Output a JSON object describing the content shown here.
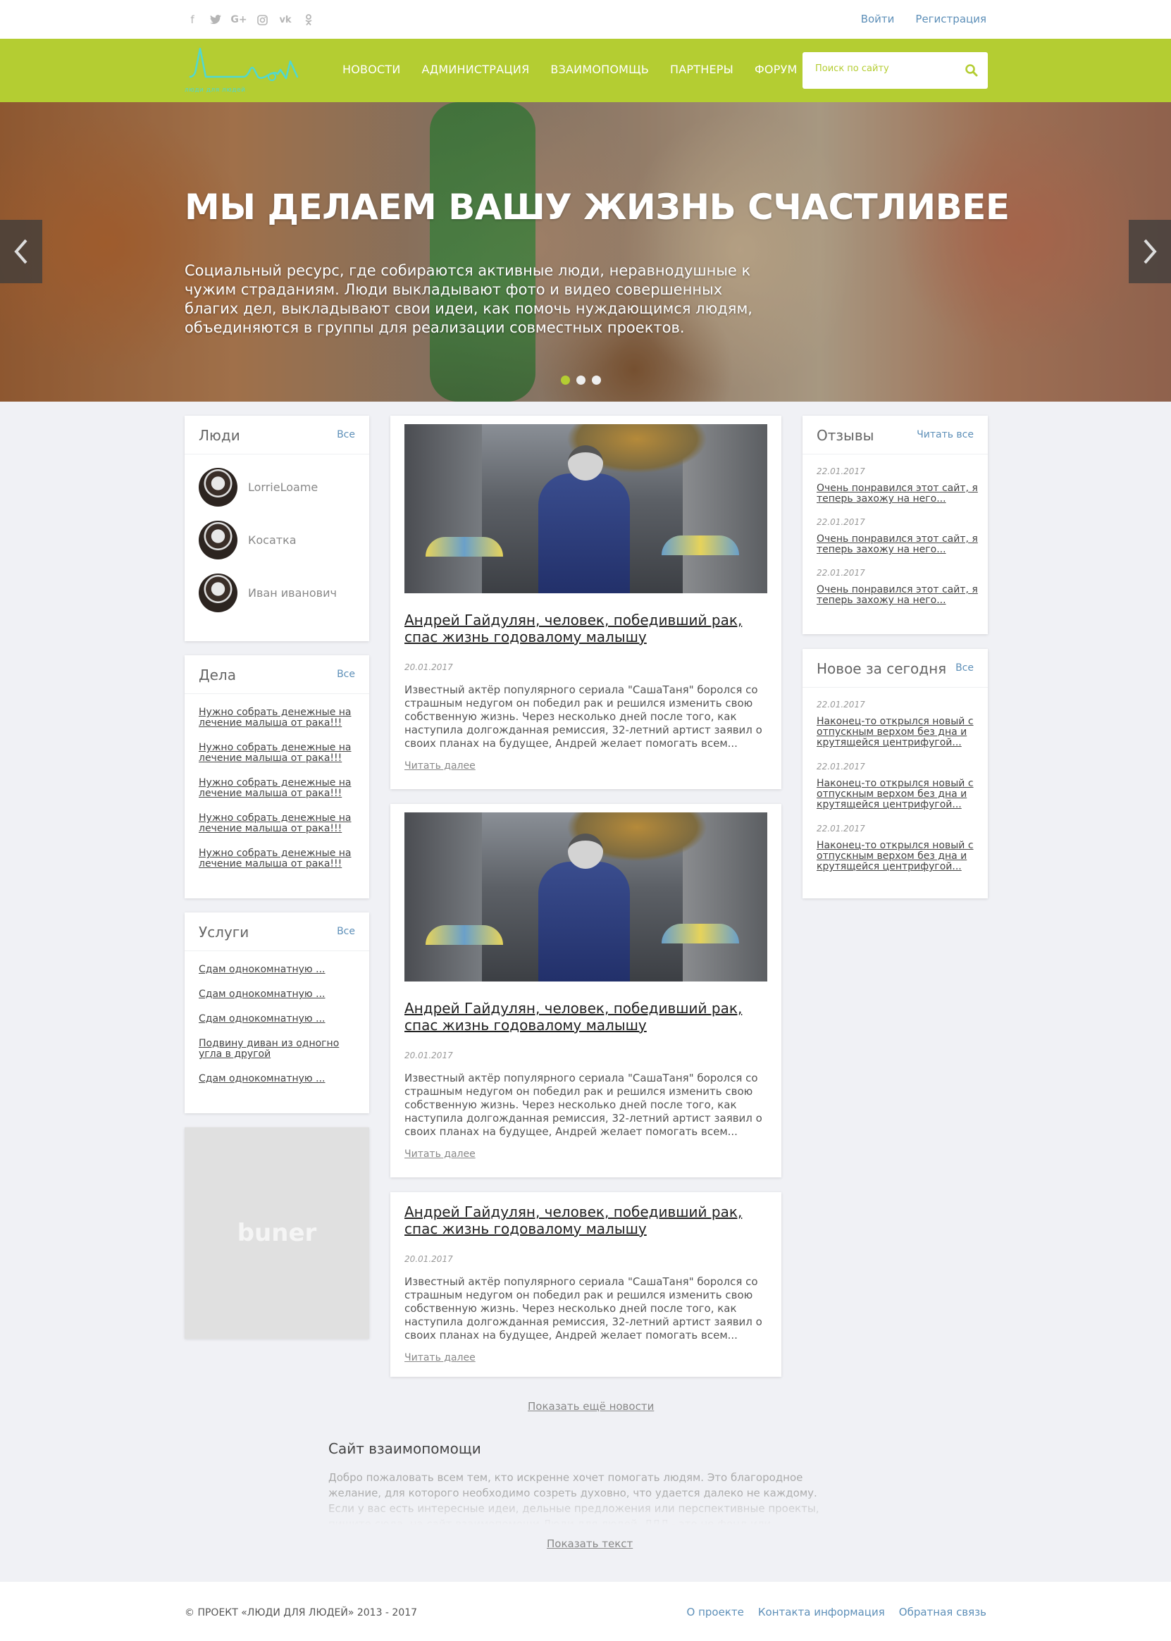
{
  "topbar": {
    "socials": [
      {
        "name": "facebook-icon",
        "glyph": "f"
      },
      {
        "name": "twitter-icon",
        "glyph": "🐦"
      },
      {
        "name": "google-plus-icon",
        "glyph": "G+"
      },
      {
        "name": "instagram-icon",
        "glyph": "◎"
      },
      {
        "name": "vk-icon",
        "glyph": "vk"
      },
      {
        "name": "odnoklassniki-icon",
        "glyph": "ok"
      }
    ],
    "login": "Войти",
    "register": "Регистрация"
  },
  "nav": {
    "logo_text": "люди для людей",
    "items": [
      "НОВОСТИ",
      "АДМИНИСТРАЦИЯ",
      "ВЗАИМОПОМЩЬ",
      "ПАРТНЕРЫ",
      "ФОРУМ"
    ],
    "search_placeholder": "Поиск по сайту",
    "accent": "#b4cd32"
  },
  "hero": {
    "title": "МЫ ДЕЛАЕМ ВАШУ ЖИЗНЬ СЧАСТЛИВЕЕ",
    "text": "Социальный ресурс, где собираются активные люди, неравнодушные к чужим страданиям. Люди выкладывают фото и видео совершенных благих дел, выкладывают свои идеи, как помочь нуждающимся людям, объединяются в группы для реализации совместных проектов.",
    "slides": 3,
    "active_slide": 1
  },
  "people": {
    "title": "Люди",
    "all": "Все",
    "items": [
      "LorrieLoame",
      "Косатка",
      "Иван иванович"
    ]
  },
  "deeds": {
    "title": "Дела",
    "all": "Все",
    "items": [
      "Нужно собрать денежные на лечение малыша от рака!!!",
      "Нужно собрать денежные на лечение малыша от рака!!!",
      "Нужно собрать денежные на лечение малыша от рака!!!",
      "Нужно собрать денежные на лечение малыша от рака!!!",
      "Нужно собрать денежные на лечение малыша от рака!!!"
    ]
  },
  "services": {
    "title": "Услуги",
    "all": "Все",
    "items": [
      "Сдам однокомнатную ...",
      "Сдам однокомнатную ...",
      "Сдам однокомнатную ...",
      "Подвину диван из одногно угла в другой",
      "Сдам однокомнатную ..."
    ]
  },
  "banner": {
    "text": "buner"
  },
  "news": [
    {
      "title": "Андрей Гайдулян, человек, победивший рак, спас жизнь годовалому малышу",
      "date": "20.01.2017",
      "text": "Известный актёр популярного сериала \"СашаТаня\" боролся со страшным недугом он победил рак и решился изменить свою собственную жизнь. Через несколько дней после того, как наступила долгожданная ремиссия, 32-летний артист заявил о своих планах на будущее, Андрей желает помогать всем...",
      "more": "Читать далее"
    },
    {
      "title": "Андрей Гайдулян, человек, победивший рак, спас жизнь годовалому малышу",
      "date": "20.01.2017",
      "text": "Известный актёр популярного сериала \"СашаТаня\" боролся со страшным недугом он победил рак и решился изменить свою собственную жизнь. Через несколько дней после того, как наступила долгожданная ремиссия, 32-летний артист заявил о своих планах на будущее, Андрей желает помогать всем...",
      "more": "Читать далее"
    },
    {
      "title": "Андрей Гайдулян, человек, победивший рак, спас жизнь годовалому малышу",
      "date": "20.01.2017",
      "text": "Известный актёр популярного сериала \"СашаТаня\" боролся со страшным недугом он победил рак и решился изменить свою собственную жизнь. Через несколько дней после того, как наступила долгожданная ремиссия, 32-летний артист заявил о своих планах на будущее, Андрей желает помогать всем...",
      "more": "Читать далее"
    }
  ],
  "more_news": "Показать ещё новости",
  "reviews": {
    "title": "Отзывы",
    "all": "Читать все",
    "items": [
      {
        "date": "22.01.2017",
        "text": "Очень понравился этот сайт, я теперь захожу на него..."
      },
      {
        "date": "22.01.2017",
        "text": "Очень понравился этот сайт, я теперь захожу на него..."
      },
      {
        "date": "22.01.2017",
        "text": "Очень понравился этот сайт, я теперь захожу на него..."
      }
    ]
  },
  "today": {
    "title": "Новое за сегодня",
    "all": "Все",
    "items": [
      {
        "date": "22.01.2017",
        "text": "Наконец-то открылся новый с отпускным верхом без дна и крутящейся центрифугой..."
      },
      {
        "date": "22.01.2017",
        "text": "Наконец-то открылся новый с отпускным верхом без дна и крутящейся центрифугой..."
      },
      {
        "date": "22.01.2017",
        "text": "Наконец-то открылся новый с отпускным верхом без дна и крутящейся центрифугой..."
      }
    ]
  },
  "about": {
    "title": "Сайт взаимопомощи",
    "text": "Добро пожаловать всем тем, кто искренне хочет помогать людям. Это благородное желание, для которого необходимо созреть духовно, что удается далеко не каждому. Если у вас есть интересные идеи, дельные предложения или перспективные проекты, пишите сюда, на сайт взаимопомощи Люди для людей. ЛДЛ - это не фонд или благотворительная",
    "show": "Показать текст"
  },
  "footer": {
    "copyright": "© ПРОЕКТ «ЛЮДИ ДЛЯ ЛЮДЕЙ» 2013 - 2017",
    "links": [
      "О проекте",
      "Контакта информация",
      "Обратная связь"
    ]
  }
}
